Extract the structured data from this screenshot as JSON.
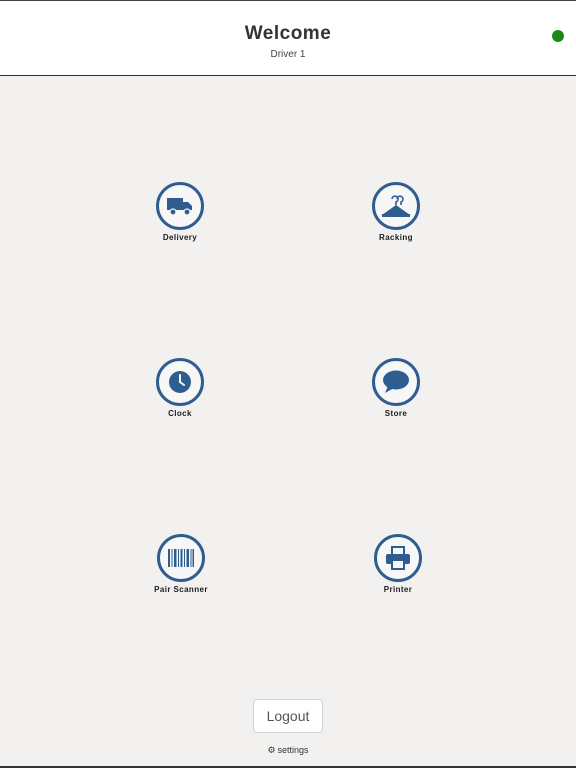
{
  "header": {
    "title": "Welcome",
    "subtitle": "Driver 1",
    "status_color": "#1b8a1b"
  },
  "menu": {
    "delivery": {
      "label": "Delivery",
      "icon": "truck-icon"
    },
    "racking": {
      "label": "Racking",
      "icon": "hanger-icon"
    },
    "clock": {
      "label": "Clock",
      "icon": "clock-icon"
    },
    "store": {
      "label": "Store",
      "icon": "chat-bubble-icon"
    },
    "pair_scanner": {
      "label": "Pair Scanner",
      "icon": "barcode-icon"
    },
    "printer": {
      "label": "Printer",
      "icon": "printer-icon"
    }
  },
  "footer": {
    "logout_label": "Logout",
    "settings_label": "settings",
    "settings_icon": "gear-icon"
  },
  "colors": {
    "accent": "#2f5d8f",
    "background": "#f2f1f0"
  }
}
